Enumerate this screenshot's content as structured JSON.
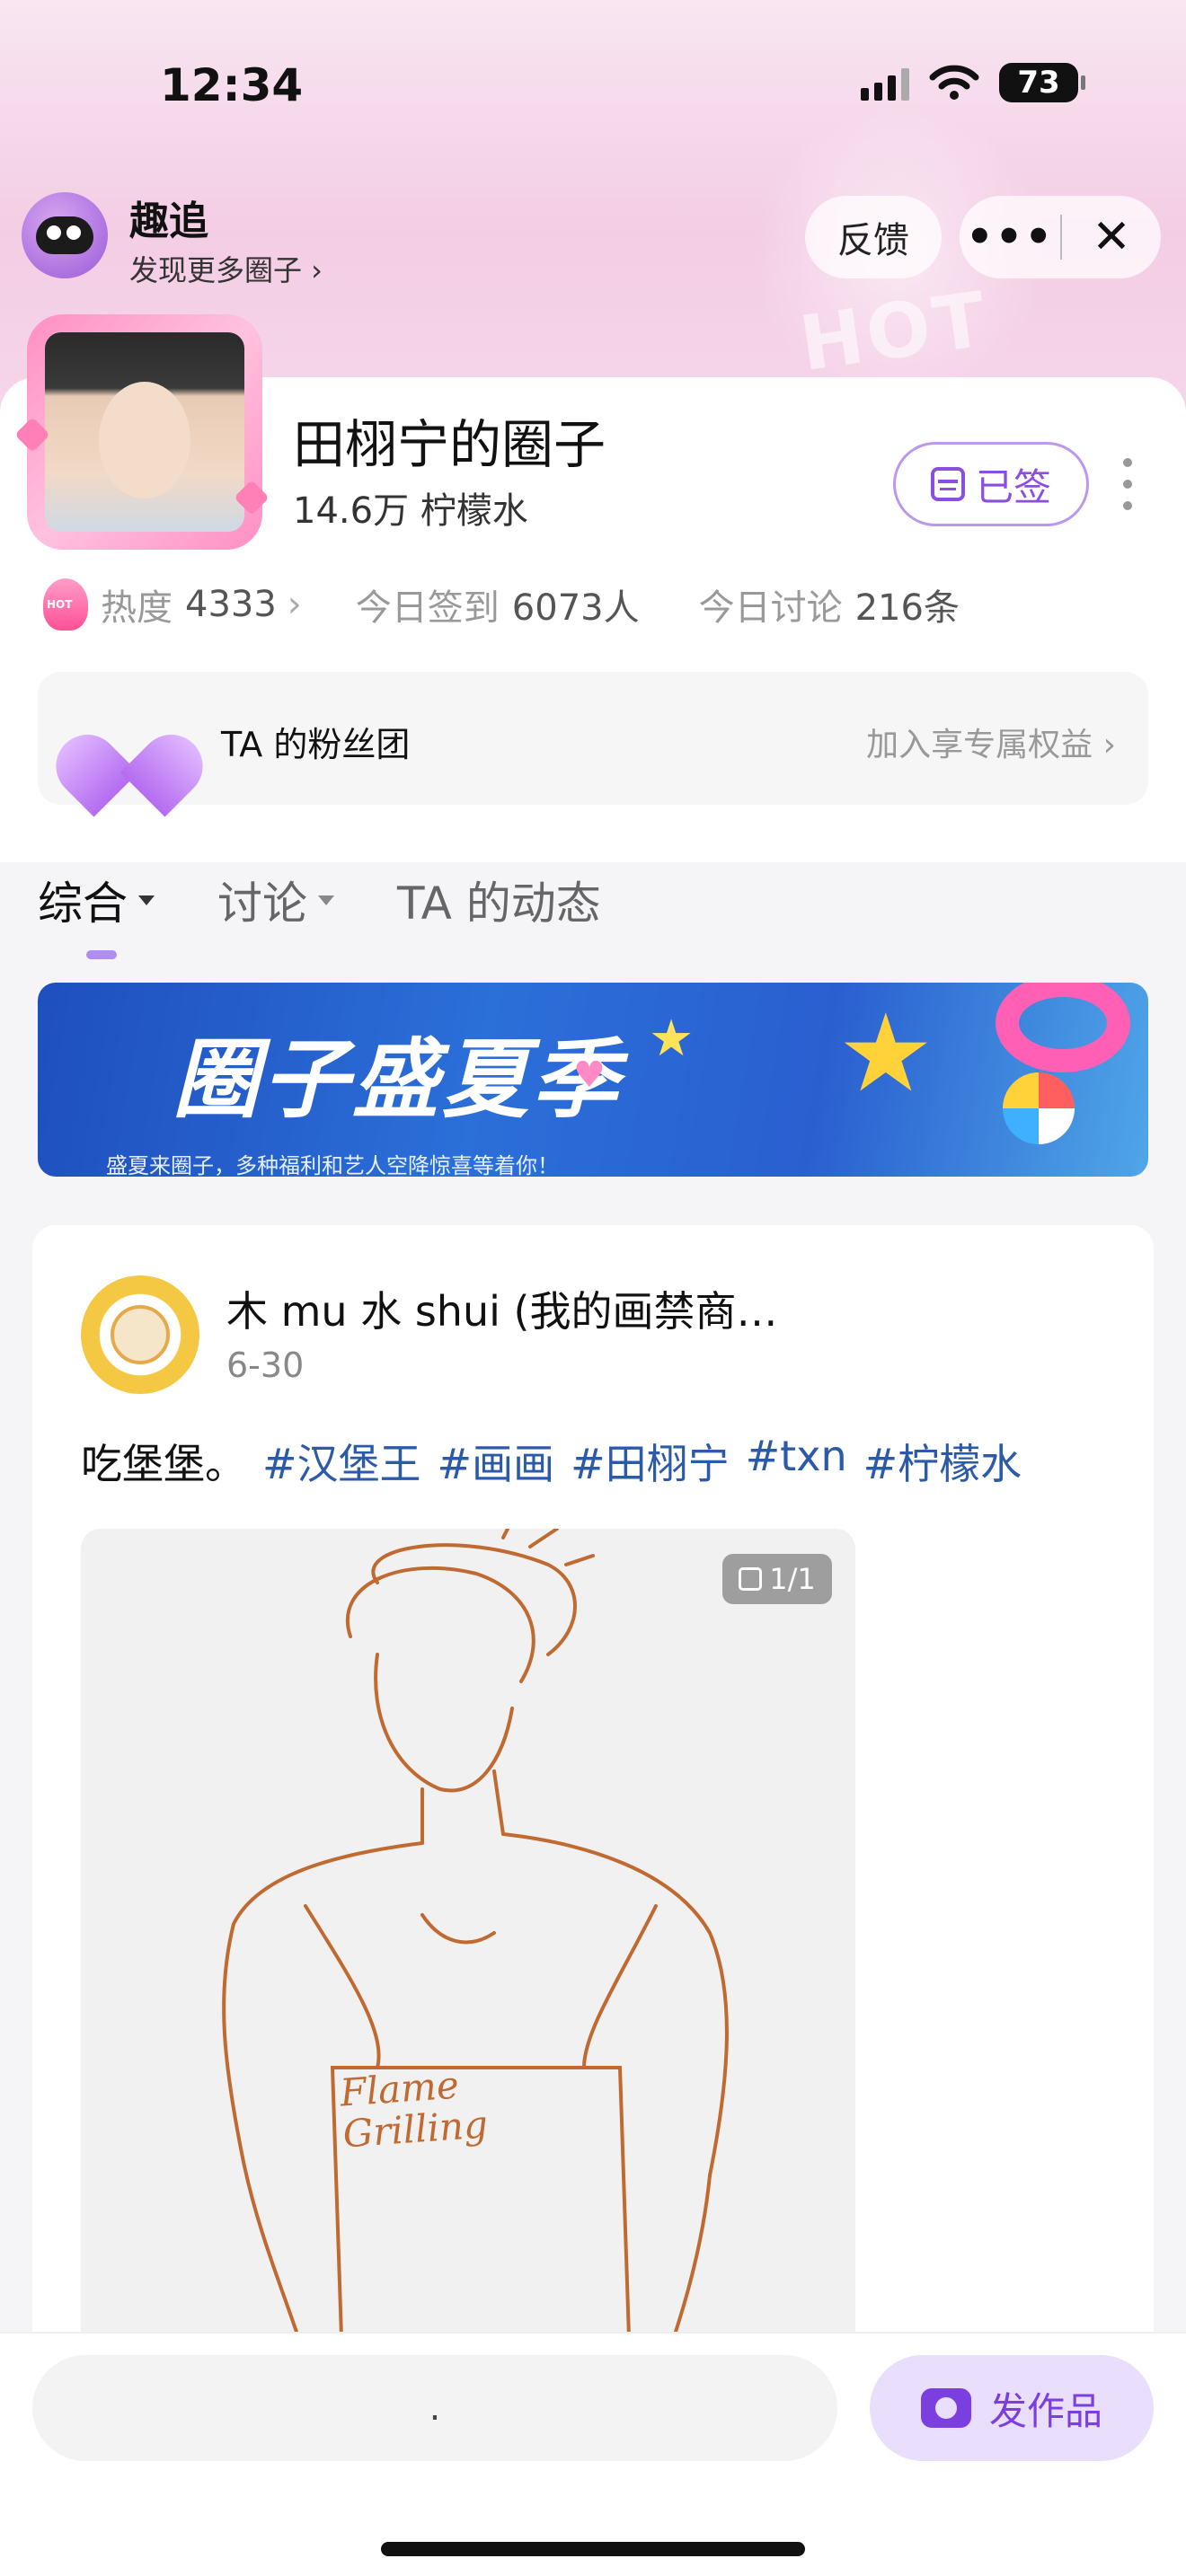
{
  "status_bar": {
    "time": "12:34",
    "battery": "73"
  },
  "app_bar": {
    "name": "趣追",
    "subtitle": "发现更多圈子 ›",
    "feedback_label": "反馈",
    "more_label": "•••",
    "close_label": "✕"
  },
  "circle": {
    "name": "田栩宁的圈子",
    "members": "14.6万 柠檬水",
    "signed_label": "已签"
  },
  "stats": {
    "heat_label": "热度",
    "heat_value": "4333",
    "checkin_label": "今日签到",
    "checkin_value": "6073人",
    "discuss_label": "今日讨论",
    "discuss_value": "216条"
  },
  "fan_club": {
    "title": "TA 的粉丝团",
    "join_label": "加入享专属权益 ›"
  },
  "tabs": [
    {
      "label": "综合"
    },
    {
      "label": "讨论"
    },
    {
      "label": "TA 的动态"
    }
  ],
  "banner": {
    "title": "圈子盛夏季",
    "subtitle": "盛夏来圈子，多种福利和艺人空降惊喜等着你！"
  },
  "post": {
    "author": "木 mu 水 shui (我的画禁商…",
    "date": "6-30",
    "text": "吃堡堡。",
    "tags": [
      "#汉堡王",
      "#画画",
      "#田栩宁",
      "#txn",
      "#柠檬水"
    ],
    "image_counter": "1/1",
    "image_text_1": "Flame",
    "image_text_2": "Grilling"
  },
  "bottom_bar": {
    "comment_placeholder": ".",
    "publish_label": "发作品"
  },
  "colors": {
    "accent": "#8a4fe0",
    "tag": "#2b5aa8",
    "header_pink": "#f3cde4"
  }
}
